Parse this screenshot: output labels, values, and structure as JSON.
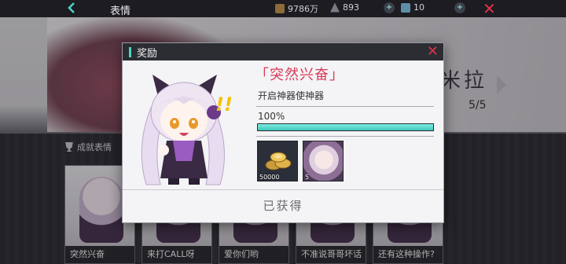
{
  "topbar": {
    "title": "表情",
    "resources": [
      {
        "name": "coin",
        "icon": "coin-icon",
        "value": "9786万"
      },
      {
        "name": "crystal",
        "icon": "crystal-icon",
        "value": "893"
      },
      {
        "name": "energy",
        "icon": "energy-icon",
        "value": "10"
      }
    ]
  },
  "background": {
    "right_name": "米拉",
    "progress": "5/5"
  },
  "achievement_tab": {
    "label": "成就表情"
  },
  "cards": [
    {
      "label": "突然兴奋"
    },
    {
      "label": "来打CALL呀"
    },
    {
      "label": "爱你们哟"
    },
    {
      "label": "不准说哥哥坏话"
    },
    {
      "label": "还有这种操作?"
    }
  ],
  "dialog": {
    "title": "奖励",
    "achievement_name": "「突然兴奋」",
    "description": "开启神器使神器",
    "progress_text": "100%",
    "progress_value": 1.0,
    "rewards": [
      {
        "icon": "gold-coins-icon",
        "quantity": "50000"
      },
      {
        "icon": "character-avatar-icon",
        "quantity": "5"
      }
    ],
    "status": "已获得"
  },
  "colors": {
    "accent": "#4fd3c4",
    "title_red": "#d63a57",
    "close_red": "#e0324a",
    "exclaim_yellow": "#f2c200"
  }
}
